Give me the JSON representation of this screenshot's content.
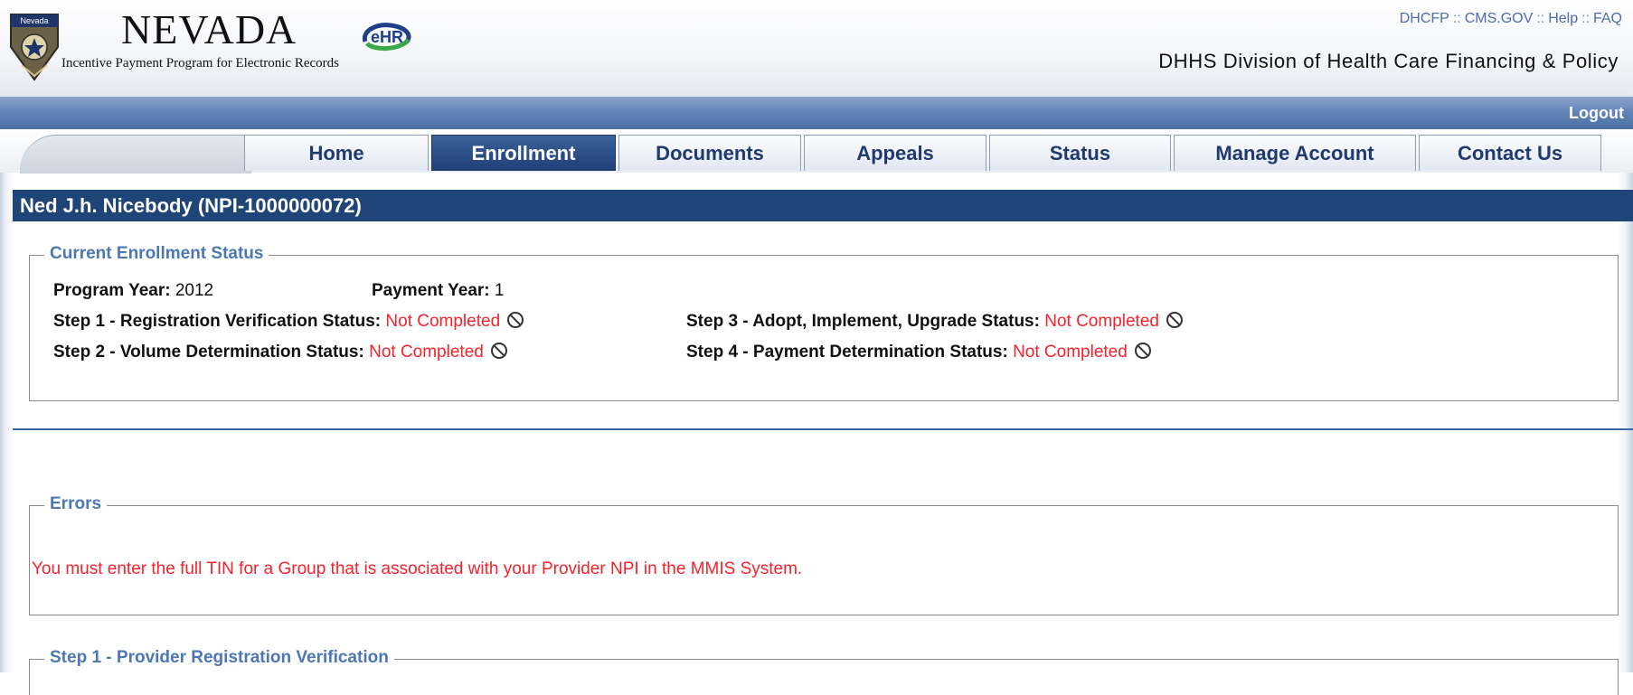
{
  "header": {
    "logo_title": "NEVADA",
    "logo_ehr": "eHR",
    "logo_subtitle": "Incentive Payment Program for Electronic Records",
    "seal_text": "Nevada",
    "top_links": [
      "DHCFP",
      "CMS.GOV",
      "Help",
      "FAQ"
    ],
    "top_link_separator": "::",
    "division": "DHHS Division of Health Care Financing & Policy"
  },
  "bluebar": {
    "logout": "Logout"
  },
  "tabs": [
    {
      "label": "Home",
      "active": false
    },
    {
      "label": "Enrollment",
      "active": true
    },
    {
      "label": "Documents",
      "active": false
    },
    {
      "label": "Appeals",
      "active": false
    },
    {
      "label": "Status",
      "active": false
    },
    {
      "label": "Manage Account",
      "active": false
    },
    {
      "label": "Contact Us",
      "active": false
    }
  ],
  "user": {
    "name": "Ned J.h. Nicebody (NPI-1000000072)"
  },
  "enrollment_status": {
    "legend": "Current Enrollment Status",
    "program_year_label": "Program Year:",
    "program_year": "2012",
    "payment_year_label": "Payment Year:",
    "payment_year": "1",
    "step1_label": "Step 1 - Registration Verification Status:",
    "step1_value": "Not Completed",
    "step2_label": "Step 2 - Volume Determination Status:",
    "step2_value": "Not Completed",
    "step3_label": "Step 3 - Adopt, Implement, Upgrade Status:",
    "step3_value": "Not Completed",
    "step4_label": "Step 4 - Payment Determination Status:",
    "step4_value": "Not Completed"
  },
  "errors": {
    "legend": "Errors",
    "message": "You must enter the full TIN for a Group that is associated with your Provider NPI in the MMIS System."
  },
  "step1": {
    "legend": "Step 1 - Provider Registration Verification"
  },
  "colors": {
    "accent": "#1e4478",
    "error": "#f5232c",
    "legend": "#4b78b4",
    "tab_active": "#1f3f77"
  }
}
